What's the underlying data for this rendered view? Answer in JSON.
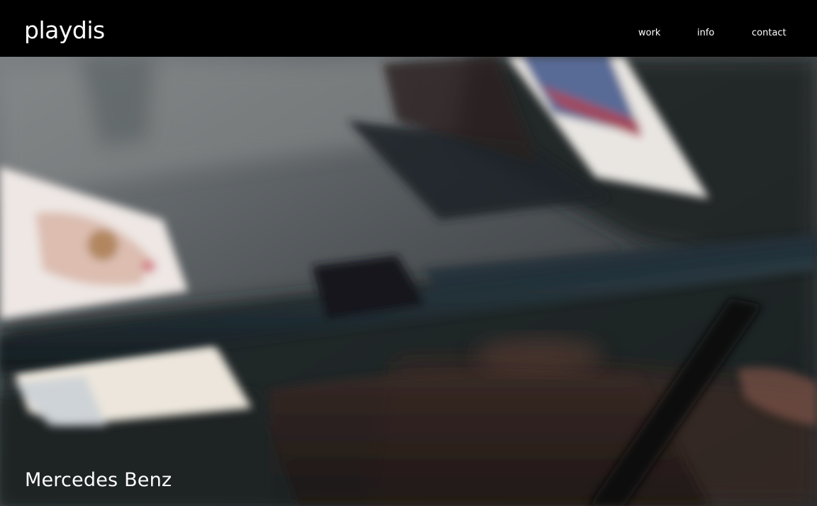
{
  "header": {
    "logo_text": "playdis",
    "nav": {
      "work": "work",
      "info": "info",
      "contact": "contact"
    }
  },
  "hero": {
    "caption": "Mercedes Benz"
  },
  "colors": {
    "header_background": "#000000",
    "text": "#ffffff"
  }
}
